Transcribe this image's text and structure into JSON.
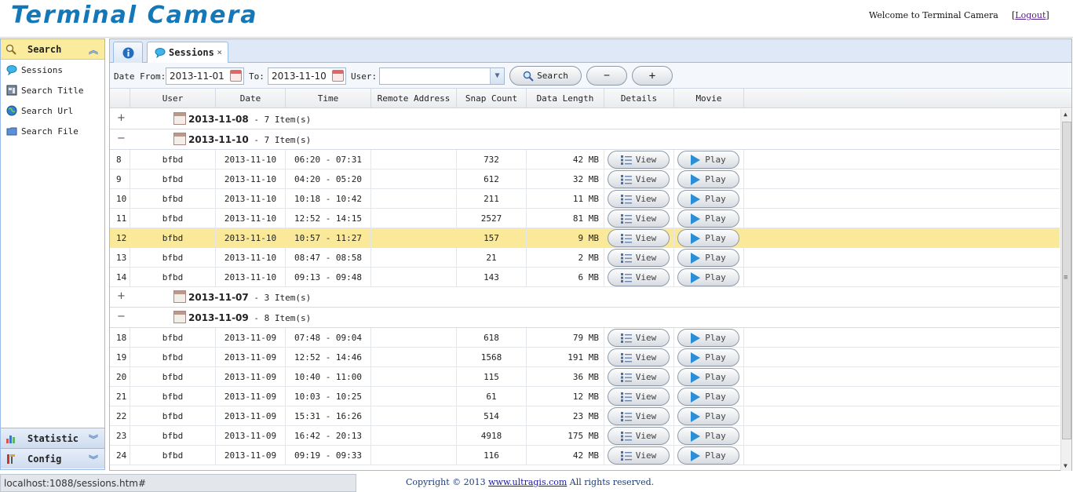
{
  "header": {
    "logo": "Terminal Camera",
    "welcome": "Welcome to Terminal Camera",
    "logout_label": "Logout"
  },
  "sidebar": {
    "search_section": "Search",
    "items": [
      {
        "label": "Sessions",
        "icon": "chat-bubble-icon"
      },
      {
        "label": "Search Title",
        "icon": "window-icon"
      },
      {
        "label": "Search Url",
        "icon": "globe-icon"
      },
      {
        "label": "Search File",
        "icon": "folder-icon"
      }
    ],
    "statistic_section": "Statistic",
    "config_section": "Config"
  },
  "tabs": {
    "sessions_label": "Sessions",
    "close_glyph": "×"
  },
  "toolbar": {
    "date_from_label": "Date From:",
    "date_from_value": "2013-11-01",
    "to_label": "To:",
    "to_value": "2013-11-10",
    "user_label": "User:",
    "search_label": "Search",
    "collapse_glyph": "−",
    "expand_glyph": "+"
  },
  "columns": [
    "User",
    "Date",
    "Time",
    "Remote Address",
    "Snap Count",
    "Data Length",
    "Details",
    "Movie"
  ],
  "buttons": {
    "view": "View",
    "play": "Play"
  },
  "groups": [
    {
      "date": "2013-11-08",
      "count": " - 7 Item(s)",
      "expanded": false,
      "rows": []
    },
    {
      "date": "2013-11-10",
      "count": " - 7 Item(s)",
      "expanded": true,
      "rows": [
        {
          "no": "8",
          "user": "bfbd",
          "date": "2013-11-10",
          "time": "06:20 - 07:31",
          "remote": "",
          "snaps": "732",
          "length": "42 MB"
        },
        {
          "no": "9",
          "user": "bfbd",
          "date": "2013-11-10",
          "time": "04:20 - 05:20",
          "remote": "",
          "snaps": "612",
          "length": "32 MB"
        },
        {
          "no": "10",
          "user": "bfbd",
          "date": "2013-11-10",
          "time": "10:18 - 10:42",
          "remote": "",
          "snaps": "211",
          "length": "11 MB"
        },
        {
          "no": "11",
          "user": "bfbd",
          "date": "2013-11-10",
          "time": "12:52 - 14:15",
          "remote": "",
          "snaps": "2527",
          "length": "81 MB"
        },
        {
          "no": "12",
          "user": "bfbd",
          "date": "2013-11-10",
          "time": "10:57 - 11:27",
          "remote": "",
          "snaps": "157",
          "length": "9 MB",
          "selected": true
        },
        {
          "no": "13",
          "user": "bfbd",
          "date": "2013-11-10",
          "time": "08:47 - 08:58",
          "remote": "",
          "snaps": "21",
          "length": "2 MB"
        },
        {
          "no": "14",
          "user": "bfbd",
          "date": "2013-11-10",
          "time": "09:13 - 09:48",
          "remote": "",
          "snaps": "143",
          "length": "6 MB"
        }
      ]
    },
    {
      "date": "2013-11-07",
      "count": " - 3 Item(s)",
      "expanded": false,
      "rows": []
    },
    {
      "date": "2013-11-09",
      "count": " - 8 Item(s)",
      "expanded": true,
      "rows": [
        {
          "no": "18",
          "user": "bfbd",
          "date": "2013-11-09",
          "time": "07:48 - 09:04",
          "remote": "",
          "snaps": "618",
          "length": "79 MB"
        },
        {
          "no": "19",
          "user": "bfbd",
          "date": "2013-11-09",
          "time": "12:52 - 14:46",
          "remote": "",
          "snaps": "1568",
          "length": "191 MB"
        },
        {
          "no": "20",
          "user": "bfbd",
          "date": "2013-11-09",
          "time": "10:40 - 11:00",
          "remote": "",
          "snaps": "115",
          "length": "36 MB"
        },
        {
          "no": "21",
          "user": "bfbd",
          "date": "2013-11-09",
          "time": "10:03 - 10:25",
          "remote": "",
          "snaps": "61",
          "length": "12 MB"
        },
        {
          "no": "22",
          "user": "bfbd",
          "date": "2013-11-09",
          "time": "15:31 - 16:26",
          "remote": "",
          "snaps": "514",
          "length": "23 MB"
        },
        {
          "no": "23",
          "user": "bfbd",
          "date": "2013-11-09",
          "time": "16:42 - 20:13",
          "remote": "",
          "snaps": "4918",
          "length": "175 MB"
        },
        {
          "no": "24",
          "user": "bfbd",
          "date": "2013-11-09",
          "time": "09:19 - 09:33",
          "remote": "",
          "snaps": "116",
          "length": "42 MB"
        }
      ]
    }
  ],
  "status": {
    "url": "localhost:1088/sessions.htm#"
  },
  "footer": {
    "prefix": "Copyright © 2013 ",
    "link": "www.ultragis.com",
    "suffix": " All rights reserved."
  },
  "colors": {
    "accent": "#1477b8",
    "selected_row": "#fbe99a",
    "panel_border": "#99bbe8"
  }
}
